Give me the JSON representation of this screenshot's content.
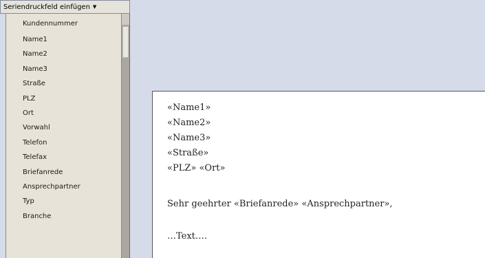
{
  "dropdown": {
    "button_label": "Seriendruckfeld einfügen",
    "arrow_icon": "triangle-down",
    "items": [
      "Kundennummer",
      "Name1",
      "Name2",
      "Name3",
      "Straße",
      "PLZ",
      "Ort",
      "Vorwahl",
      "Telefon",
      "Telefax",
      "Briefanrede",
      "Ansprechpartner",
      "Typ",
      "Branche"
    ]
  },
  "document": {
    "lines": [
      "«Name1»",
      "«Name2»",
      "«Name3»",
      "«Straße»",
      "«PLZ» «Ort»",
      "Sehr geehrter «Briefanrede» «Ansprechpartner»,",
      "…Text…."
    ]
  }
}
